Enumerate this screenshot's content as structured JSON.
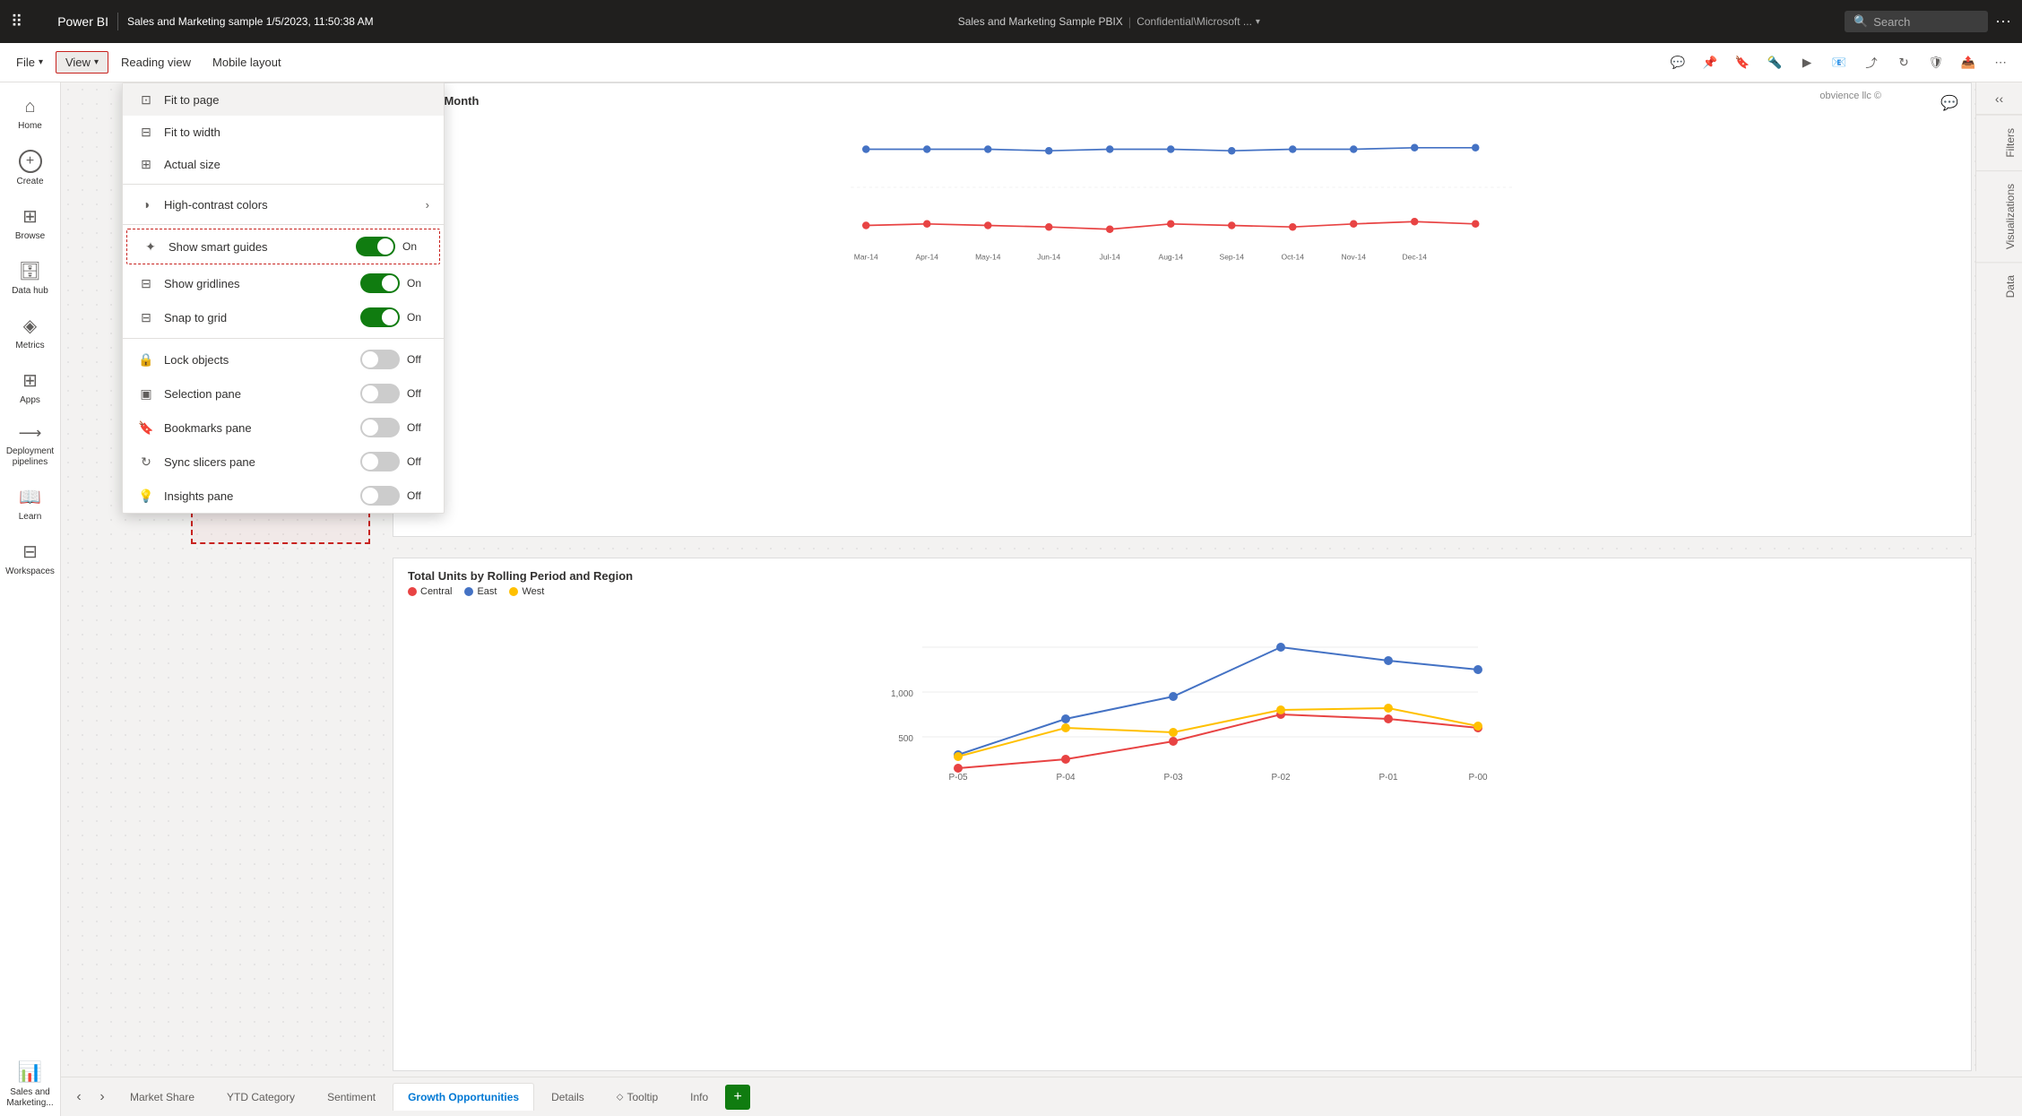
{
  "topbar": {
    "appname": "Power BI",
    "doctitle": "Sales and Marketing sample 1/5/2023, 11:50:38 AM",
    "pbix_label": "Sales and Marketing Sample PBIX",
    "confidential": "Confidential\\Microsoft ...",
    "search_placeholder": "Search",
    "more_icon": "⋯"
  },
  "ribbon": {
    "file_label": "File",
    "view_label": "View",
    "reading_view_label": "Reading view",
    "mobile_layout_label": "Mobile layout"
  },
  "view_menu": {
    "items": [
      {
        "icon": "⊡",
        "label": "Fit to page",
        "has_toggle": false,
        "has_arrow": false,
        "highlighted": true
      },
      {
        "icon": "⊟",
        "label": "Fit to width",
        "has_toggle": false,
        "has_arrow": false
      },
      {
        "icon": "⊞",
        "label": "Actual size",
        "has_toggle": false,
        "has_arrow": false
      },
      {
        "icon": "◑",
        "label": "High-contrast colors",
        "has_toggle": false,
        "has_arrow": true
      },
      {
        "icon": "✦",
        "label": "Show smart guides",
        "has_toggle": true,
        "toggle_state": "on",
        "toggle_label": "On"
      },
      {
        "icon": "⊟",
        "label": "Show gridlines",
        "has_toggle": true,
        "toggle_state": "on",
        "toggle_label": "On"
      },
      {
        "icon": "⊟",
        "label": "Snap to grid",
        "has_toggle": true,
        "toggle_state": "on",
        "toggle_label": "On"
      },
      {
        "icon": "🔒",
        "label": "Lock objects",
        "has_toggle": true,
        "toggle_state": "off",
        "toggle_label": "Off"
      },
      {
        "icon": "▣",
        "label": "Selection pane",
        "has_toggle": true,
        "toggle_state": "off",
        "toggle_label": "Off"
      },
      {
        "icon": "🔖",
        "label": "Bookmarks pane",
        "has_toggle": true,
        "toggle_state": "off",
        "toggle_label": "Off"
      },
      {
        "icon": "↻",
        "label": "Sync slicers pane",
        "has_toggle": true,
        "toggle_state": "off",
        "toggle_label": "Off"
      },
      {
        "icon": "💡",
        "label": "Insights pane",
        "has_toggle": true,
        "toggle_state": "off",
        "toggle_label": "Off"
      }
    ]
  },
  "sidebar": {
    "items": [
      {
        "id": "home",
        "icon": "⌂",
        "label": "Home"
      },
      {
        "id": "create",
        "icon": "+",
        "label": "Create"
      },
      {
        "id": "browse",
        "icon": "⊞",
        "label": "Browse"
      },
      {
        "id": "datahub",
        "icon": "⊟",
        "label": "Data hub"
      },
      {
        "id": "metrics",
        "icon": "◈",
        "label": "Metrics"
      },
      {
        "id": "apps",
        "icon": "⊞",
        "label": "Apps"
      },
      {
        "id": "deployment",
        "icon": "⊟",
        "label": "Deployment pipelines"
      },
      {
        "id": "learn",
        "icon": "📖",
        "label": "Learn"
      },
      {
        "id": "workspaces",
        "icon": "⊟",
        "label": "Workspaces"
      },
      {
        "id": "salesmarketing",
        "icon": "📊",
        "label": "Sales and Marketing..."
      }
    ]
  },
  "canvas": {
    "top_chart_title": "Ms by Month",
    "bottom_chart_title": "Total Units by Rolling Period and Region",
    "legend": [
      {
        "label": "Central",
        "color": "#e84343"
      },
      {
        "label": "East",
        "color": "#4472c4"
      },
      {
        "label": "West",
        "color": "#ffc000"
      }
    ],
    "obvience_label": "obvience llc ©",
    "x_labels_top": [
      "Mar-14",
      "Apr-14",
      "May-14",
      "Jun-14",
      "Jul-14",
      "Aug-14",
      "Sep-14",
      "Oct-14",
      "Nov-14",
      "Dec-14"
    ],
    "x_labels_bottom": [
      "P-05",
      "P-04",
      "P-03",
      "P-02",
      "P-01",
      "P-00"
    ],
    "y_labels_bottom": [
      "500",
      "1,000"
    ]
  },
  "right_panels": {
    "filters": "Filters",
    "visualizations": "Visualizations",
    "data": "Data"
  },
  "page_tabs": {
    "tabs": [
      {
        "label": "Market Share",
        "active": false
      },
      {
        "label": "YTD Category",
        "active": false
      },
      {
        "label": "Sentiment",
        "active": false
      },
      {
        "label": "Growth Opportunities",
        "active": true
      },
      {
        "label": "Details",
        "active": false
      },
      {
        "label": "Tooltip",
        "active": false,
        "has_icon": true
      },
      {
        "label": "Info",
        "active": false
      }
    ],
    "add_label": "+"
  }
}
